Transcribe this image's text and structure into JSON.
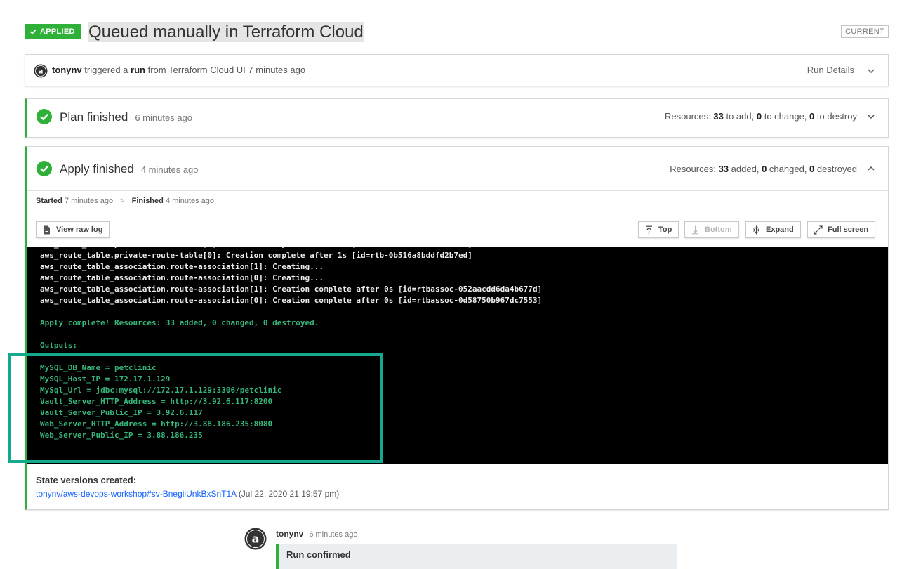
{
  "header": {
    "status_badge": "APPLIED",
    "title": "Queued manually in Terraform Cloud",
    "current_badge": "CURRENT"
  },
  "trigger": {
    "user": "tonynv",
    "triggered_text": "triggered a",
    "run_word": "run",
    "from_text": "from Terraform Cloud UI 7 minutes ago",
    "details_label": "Run Details"
  },
  "plan": {
    "title": "Plan finished",
    "time": "6 minutes ago",
    "resources_label": "Resources:",
    "add_count": "33",
    "add_label": "to add,",
    "change_count": "0",
    "change_label": "to change,",
    "destroy_count": "0",
    "destroy_label": "to destroy"
  },
  "apply": {
    "title": "Apply finished",
    "time": "4 minutes ago",
    "resources_label": "Resources:",
    "added_count": "33",
    "added_label": "added,",
    "changed_count": "0",
    "changed_label": "changed,",
    "destroyed_count": "0",
    "destroyed_label": "destroyed",
    "started_label": "Started",
    "started_time": "7 minutes ago",
    "timing_sep": ">",
    "finished_label": "Finished",
    "finished_time": "4 minutes ago",
    "buttons": {
      "raw_log": "View raw log",
      "top": "Top",
      "bottom": "Bottom",
      "expand": "Expand",
      "full_screen": "Full screen"
    },
    "log": [
      {
        "text": "aws_route_table.private-route-table[0]: Creation complete after 1s [id=rtb-0b516a8bddfd2b7ed]",
        "color": "white"
      },
      {
        "text": "aws_route_table.private-route-table[0]: Creation complete after 1s [id=rtb-0b516a8bddfd2b7ed]",
        "color": "white"
      },
      {
        "text": "aws_route_table_association.route-association[1]: Creating...",
        "color": "white"
      },
      {
        "text": "aws_route_table_association.route-association[0]: Creating...",
        "color": "white"
      },
      {
        "text": "aws_route_table_association.route-association[1]: Creation complete after 0s [id=rtbassoc-052aacdd6da4b677d]",
        "color": "white"
      },
      {
        "text": "aws_route_table_association.route-association[0]: Creation complete after 0s [id=rtbassoc-0d58750b967dc7553]",
        "color": "white"
      },
      {
        "text": "",
        "color": "white"
      },
      {
        "text": "Apply complete! Resources: 33 added, 0 changed, 0 destroyed.",
        "color": "green"
      },
      {
        "text": "",
        "color": "white"
      },
      {
        "text": "Outputs:",
        "color": "green"
      },
      {
        "text": "",
        "color": "white"
      },
      {
        "text": "MySQL_DB_Name = petclinic",
        "color": "green"
      },
      {
        "text": "MySQL_Host_IP = 172.17.1.129",
        "color": "green"
      },
      {
        "text": "MySql_Url = jdbc:mysql://172.17.1.129:3306/petclinic",
        "color": "green"
      },
      {
        "text": "Vault_Server_HTTP_Address = http://3.92.6.117:8200",
        "color": "green"
      },
      {
        "text": "Vault_Server_Public_IP = 3.92.6.117",
        "color": "green"
      },
      {
        "text": "Web_Server_HTTP_Address = http://3.88.186.235:8080",
        "color": "green"
      },
      {
        "text": "Web_Server_Public_IP = 3.88.186.235",
        "color": "green"
      }
    ],
    "state_label": "State versions created:",
    "state_link": "tonynv/aws-devops-workshop#sv-BnegiiUnkBxSnT1A",
    "state_date": "(Jul 22, 2020 21:19:57 pm)"
  },
  "comment": {
    "user": "tonynv",
    "time": "6 minutes ago",
    "text": "Run confirmed"
  },
  "colors": {
    "success_green": "#2eb039",
    "log_green": "#37b67a",
    "highlight_teal": "#14a88f",
    "link_blue": "#1563ff"
  }
}
